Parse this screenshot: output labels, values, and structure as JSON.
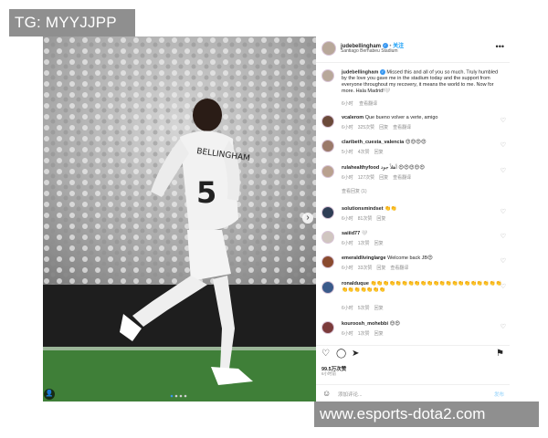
{
  "watermarks": {
    "top_left": "TG: MYYJJPP",
    "bottom_right": "www.esports-dota2.com"
  },
  "photo": {
    "jersey_name": "BELLINGHAM",
    "jersey_number": "5",
    "next_glyph": "›",
    "tag_glyph": "👤"
  },
  "post": {
    "username": "judebellingham",
    "follow_label": "关注",
    "location": "Santiago Bernabeu Stadium",
    "more_glyph": "•••",
    "caption_user": "judebellingham",
    "caption_text": "Missed this and all of you so much. Truly humbled by the love you gave me in the stadium today and the support from everyone throughout my recovery, it means the world to me. Now for more. Hala Madrid!🤍",
    "caption_time": "6小时",
    "caption_translate": "查看翻译",
    "likes": "99.5万次赞",
    "time": "6小时前",
    "add_comment_placeholder": "添加评论...",
    "post_label": "发布",
    "comments": [
      {
        "user": "vcalerom",
        "text": "Que bueno volver a verte, amigo",
        "time": "6小时",
        "likes": "325次赞",
        "reply": "回复",
        "translate": "查看翻译"
      },
      {
        "user": "claribeth_cuesta_valencia",
        "text": "😍😍😍😍",
        "time": "5小时",
        "likes": "4次赞",
        "reply": "回复",
        "translate": ""
      },
      {
        "user": "rulahealthyfood",
        "text": "أهلاً جود 😍😍😍😍😍",
        "time": "6小时",
        "likes": "127次赞",
        "reply": "回复",
        "translate": "查看翻译",
        "extra": "查看回复 (1)"
      },
      {
        "user": "solutionsmindset",
        "text": "👏👏",
        "time": "6小时",
        "likes": "81次赞",
        "reply": "回复",
        "translate": ""
      },
      {
        "user": "saiiid77",
        "text": "🤍",
        "time": "6小时",
        "likes": "1次赞",
        "reply": "回复",
        "translate": ""
      },
      {
        "user": "emeraldlivinglarge",
        "text": "Welcome back JB😍",
        "time": "6小时",
        "likes": "33次赞",
        "reply": "回复",
        "translate": "查看翻译"
      },
      {
        "user": "ronalduque",
        "text": "👏👏👏👏👏👏👏👏👏👏👏👏👏👏👏👏👏👏👏👏👏👏👏👏👏👏👏👏",
        "time": "6小时",
        "likes": "5次赞",
        "reply": "回复",
        "translate": ""
      },
      {
        "user": "kouroosh_mohebbi",
        "text": "😍😍",
        "time": "6小时",
        "likes": "1次赞",
        "reply": "回复",
        "translate": ""
      }
    ]
  },
  "icons": {
    "like": "♡",
    "comment": "◯",
    "share": "➤",
    "save": "⚑",
    "emoji": "☺",
    "comment_heart": "♡"
  }
}
